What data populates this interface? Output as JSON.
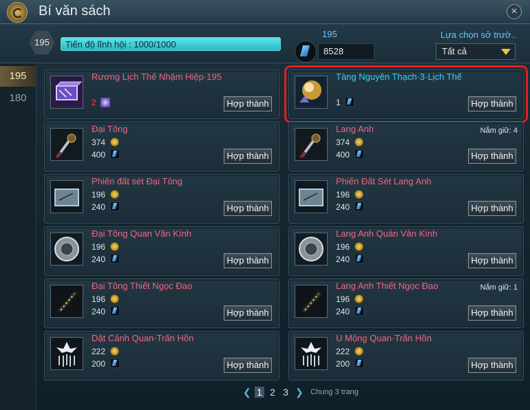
{
  "window": {
    "title": "Bí văn sách"
  },
  "header": {
    "level": "195",
    "progress_label": "Tiến độ lĩnh hội : 1000/1000",
    "progress_fraction": 1.0,
    "resource_top": "195",
    "resource_amount": "8528",
    "filter_label": "Lựa chọn sở trườ..",
    "filter_value": "Tất cả"
  },
  "sidebar": {
    "tabs": [
      {
        "label": "195"
      },
      {
        "label": "180"
      }
    ]
  },
  "items": [
    {
      "name": "Rương Lịch Thế Nhậm Hiệp·195",
      "name_color": "pink",
      "icon": "chest-icon",
      "gem_qty": "2",
      "gem_qty_red": true,
      "gem_type": "chest",
      "button": "Hợp thành"
    },
    {
      "name": "Tàng Nguyên Thạch·3·Lịch Thế",
      "name_color": "blue",
      "icon": "orb-icon",
      "gem_qty": "1",
      "gem_type": "gem",
      "button": "Hợp thành",
      "selected": true
    },
    {
      "name": "Đại Tông",
      "icon": "sword-icon",
      "coin": "374",
      "gem": "400",
      "button": "Hợp thành"
    },
    {
      "name": "Lang Anh",
      "icon": "sword-icon",
      "coin": "374",
      "gem": "400",
      "held": "Nắm giữ: 4",
      "button": "Hợp thành"
    },
    {
      "name": "Phiến đất sét Đại Tông",
      "icon": "tablet-icon",
      "coin": "196",
      "gem": "240",
      "button": "Hợp thành"
    },
    {
      "name": "Phiến Đất Sét Lang Anh",
      "icon": "tablet-icon",
      "coin": "196",
      "gem": "240",
      "button": "Hợp thành"
    },
    {
      "name": "Đại Tông Quan Vân Kính",
      "icon": "mirror-icon",
      "coin": "196",
      "gem": "240",
      "button": "Hợp thành"
    },
    {
      "name": "Lang Anh Quán Vân Kính",
      "icon": "mirror-icon",
      "coin": "196",
      "gem": "240",
      "button": "Hợp thành"
    },
    {
      "name": "Đại Tông Thiết Ngọc Đao",
      "icon": "blade-icon",
      "coin": "196",
      "gem": "240",
      "button": "Hợp thành"
    },
    {
      "name": "Lang Anh Thiết Ngọc Đao",
      "icon": "blade-icon",
      "coin": "196",
      "gem": "240",
      "held": "Nắm giữ: 1",
      "button": "Hợp thành"
    },
    {
      "name": "Dật Cảnh Quan·Trấn Hồn",
      "icon": "lotus-charm-icon",
      "coin": "222",
      "gem": "200",
      "button": "Hợp thành"
    },
    {
      "name": "U Mộng Quan·Trấn Hồn",
      "icon": "lotus-charm-icon",
      "coin": "222",
      "gem": "200",
      "button": "Hợp thành"
    }
  ],
  "pager": {
    "pages": [
      "1",
      "2",
      "3"
    ],
    "current": "1",
    "total_label": "Chung 3 trang"
  }
}
